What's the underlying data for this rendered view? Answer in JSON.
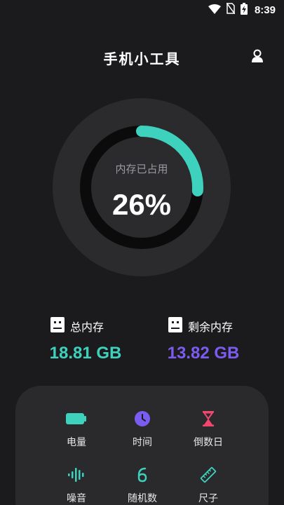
{
  "status_bar": {
    "time": "8:39"
  },
  "header": {
    "title": "手机小工具"
  },
  "memory_ring": {
    "label": "内存已占用",
    "percent_text": "26%",
    "percent": 26,
    "track_color": "#000000",
    "arc_color": "#3ed2be",
    "outer_color": "#2b2b2e"
  },
  "total_memory": {
    "title": "总内存",
    "value": "18.81 GB",
    "color": "#3ed2be"
  },
  "free_memory": {
    "title": "剩余内存",
    "value": "13.82 GB",
    "color": "#7b5cf0"
  },
  "tools": [
    {
      "label": "电量",
      "icon": "battery-icon",
      "color": "#3ed2be"
    },
    {
      "label": "时间",
      "icon": "clock-icon",
      "color": "#7b5cf0"
    },
    {
      "label": "倒数日",
      "icon": "hourglass-icon",
      "color": "#f2466e"
    },
    {
      "label": "噪音",
      "icon": "soundwave-icon",
      "color": "#3ed2be"
    },
    {
      "label": "随机数",
      "icon": "dice-six-icon",
      "color": "#3ed2be"
    },
    {
      "label": "尺子",
      "icon": "ruler-icon",
      "color": "#3ed2be"
    }
  ]
}
